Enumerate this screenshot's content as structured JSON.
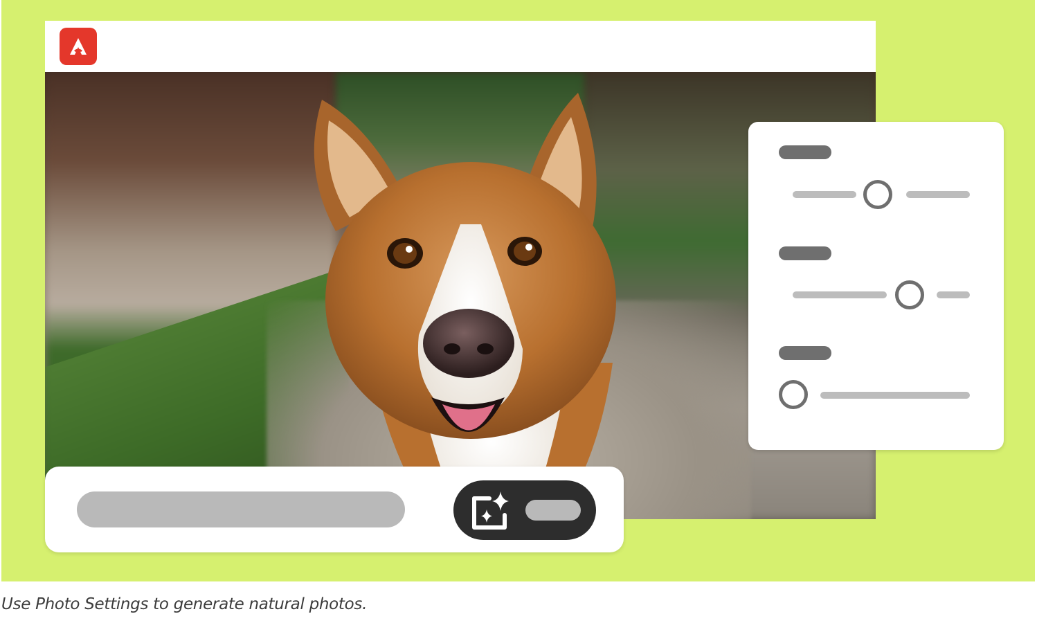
{
  "colors": {
    "canvas_background": "#d6f06f",
    "logo_red": "#e4372b",
    "panel_background": "#ffffff",
    "control_gray": "#6f6f6f",
    "placeholder_gray": "#b9b9b9",
    "generate_button": "#2d2d2d"
  },
  "app": {
    "logo_icon": "adobe-express-logo-icon"
  },
  "photo": {
    "subject": "dog-photo"
  },
  "settings_panel": {
    "sliders": [
      {
        "level_percent": 49
      },
      {
        "level_percent": 67
      },
      {
        "level_percent": 0
      }
    ]
  },
  "prompt_bar": {
    "generate_icon": "generate-sparkle-icon"
  },
  "caption": {
    "text": "Use Photo Settings to generate natural photos."
  }
}
